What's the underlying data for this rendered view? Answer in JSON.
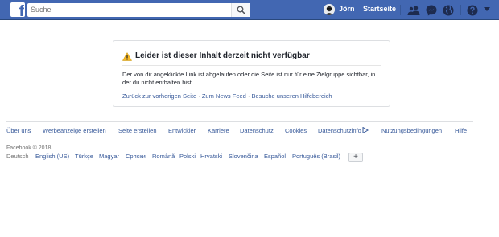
{
  "header": {
    "logo_letter": "f",
    "search_placeholder": "Suche",
    "user_name": "Jörn",
    "home_label": "Startseite",
    "icons": [
      "search-icon",
      "friends-icon",
      "messenger-icon",
      "notifications-globe-icon",
      "help-icon",
      "menu-caret-icon"
    ]
  },
  "error": {
    "title": "Leider ist dieser Inhalt derzeit nicht verfügbar",
    "body": "Der von dir angeklickte Link ist abgelaufen oder die Seite ist nur für eine Zielgruppe sichtbar, in der du nicht enthalten bist.",
    "links": {
      "back": "Zurück zur vorherigen Seite",
      "news_feed": "Zum News Feed",
      "help": "Besuche unseren Hilfebereich"
    },
    "separator": "·"
  },
  "footer": {
    "links": {
      "about": "Über uns",
      "create_ad": "Werbeanzeige erstellen",
      "create_page": "Seite erstellen",
      "developers": "Entwickler",
      "careers": "Karriere",
      "privacy": "Datenschutz",
      "cookies": "Cookies",
      "adchoices": "Datenschutzinfo",
      "terms": "Nutzungsbedingungen",
      "help": "Hilfe"
    },
    "copyright": "Facebook © 2018",
    "languages": {
      "current": "Deutsch",
      "english": "English (US)",
      "turkish": "Türkçe",
      "hungarian": "Magyar",
      "serbian": "Српски",
      "romanian": "Română",
      "polish": "Polski",
      "croatian": "Hrvatski",
      "slovak": "Slovenčina",
      "spanish": "Español",
      "portuguese": "Português (Brasil)"
    },
    "add_language": "+"
  },
  "colors": {
    "brand_blue": "#4267b2",
    "link_blue": "#365899",
    "warning": "#f7b928"
  }
}
